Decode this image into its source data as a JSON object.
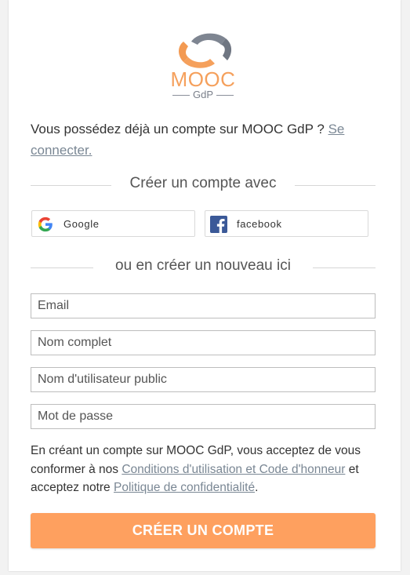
{
  "brand": {
    "logo_text": "MOOC",
    "logo_subtext": "GdP",
    "accent_color": "#fea05f",
    "logo_orange": "#f5a05c",
    "logo_gray": "#8a8f9a"
  },
  "signin_prompt": {
    "text": "Vous possédez déjà un compte sur MOOC GdP ? ",
    "link_label": "Se connecter."
  },
  "social_section": {
    "heading": "Créer un compte avec",
    "buttons": [
      {
        "label": "Google",
        "icon": "google-icon"
      },
      {
        "label": "facebook",
        "icon": "facebook-icon"
      }
    ]
  },
  "register_section": {
    "heading": "ou en créer un nouveau ici"
  },
  "form": {
    "email_placeholder": "Email",
    "fullname_placeholder": "Nom complet",
    "username_placeholder": "Nom d'utilisateur public",
    "password_placeholder": "Mot de passe"
  },
  "terms": {
    "prefix": "En créant un compte sur MOOC GdP, vous acceptez de vous conformer à nos ",
    "tos_link": "Conditions d'utilisation et Code d'honneur",
    "middle": " et acceptez notre ",
    "privacy_link": "Politique de confidentialité",
    "suffix": "."
  },
  "submit": {
    "label": "CRÉER UN COMPTE"
  }
}
